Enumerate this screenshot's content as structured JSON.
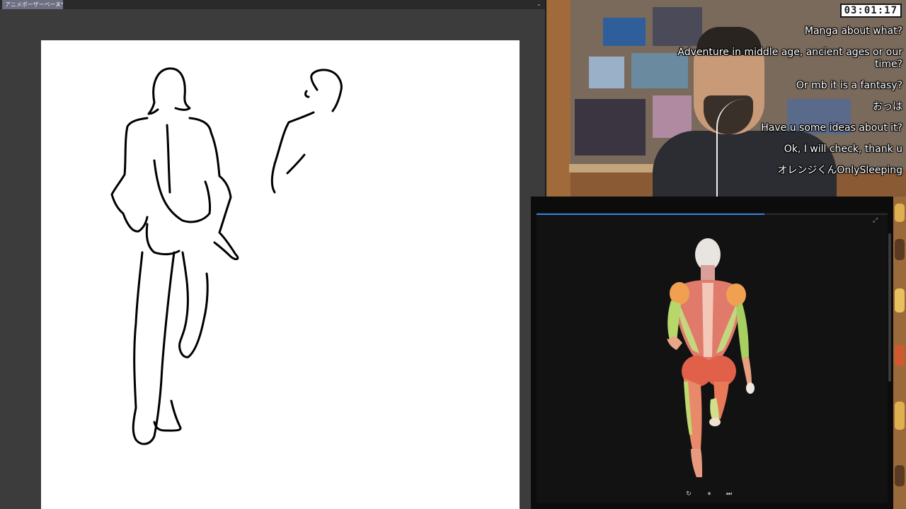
{
  "app": {
    "document_tab": "アニメポーザーベース*",
    "close_glyph": "×",
    "overflow_glyph": "⌄"
  },
  "overlay": {
    "timer": "03:01:17",
    "chat": [
      "Manga about what?",
      "Adventure in middle age, ancient ages or our time?",
      "Or mb it is a fantasy?",
      "おっは",
      "Have u some ideas about it?",
      "Ok, I will check, thank u",
      "オレンジくんOnlySleeping"
    ]
  },
  "viewer": {
    "progress_fraction": 0.65,
    "controls": {
      "reset_glyph": "↻",
      "pause_glyph": "⏸",
      "next_glyph": "⏭"
    },
    "expand_glyph": "⤢"
  },
  "colors": {
    "accent": "#2e86de",
    "canvas": "#ffffff",
    "app_bg": "#3c3c3c",
    "viewer_bg": "#121212"
  }
}
